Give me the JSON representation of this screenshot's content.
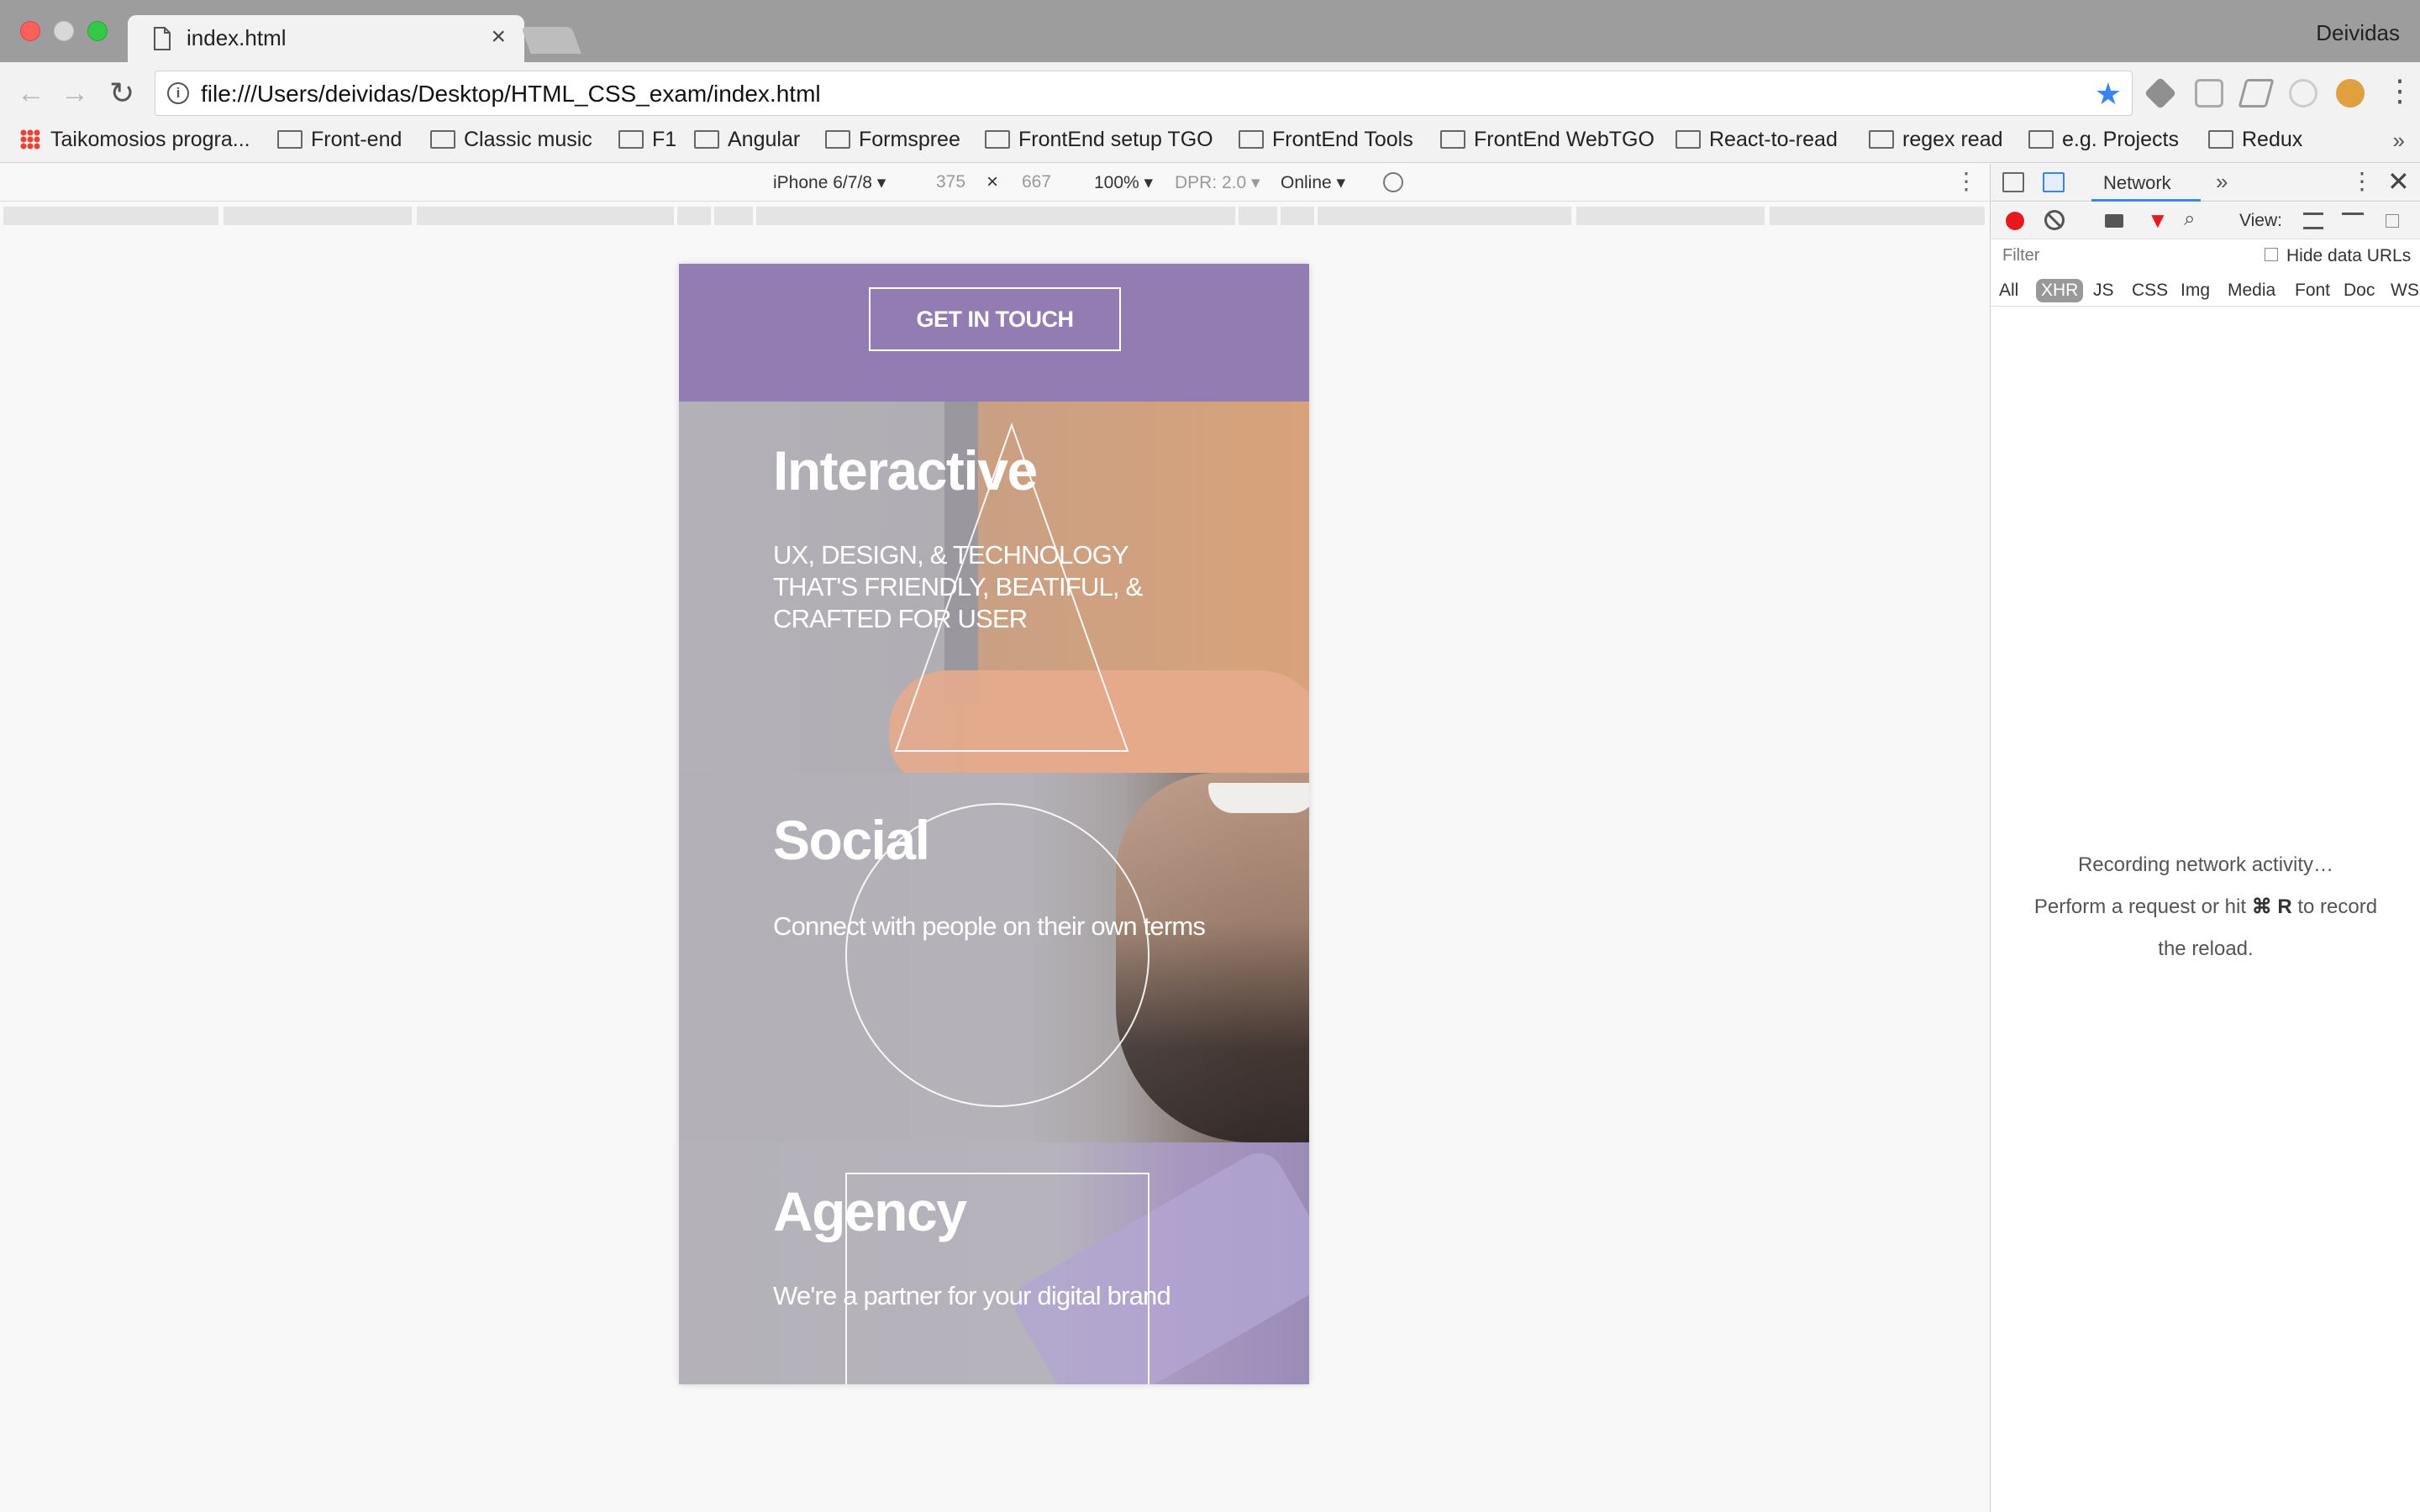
{
  "window": {
    "tab_title": "index.html",
    "tab_close": "×",
    "profile_name": "Deividas"
  },
  "toolbar": {
    "back": "←",
    "forward": "→",
    "reload": "↻",
    "info": "i",
    "url": "file:///Users/deividas/Desktop/HTML_CSS_exam/index.html",
    "star": "★",
    "menu": "⋮"
  },
  "bookmarks": [
    "Taikomosios progra...",
    "Front-end",
    "Classic music",
    "F1",
    "Angular",
    "Formspree",
    "FrontEnd setup TGO",
    "FrontEnd Tools",
    "FrontEnd WebTGO",
    "React-to-read",
    "regex read",
    "e.g. Projects",
    "Redux"
  ],
  "bookmarks_more": "»",
  "device_toolbar": {
    "device": "iPhone 6/7/8 ▾",
    "width": "375",
    "times": "×",
    "height": "667",
    "zoom": "100% ▾",
    "dpr": "DPR: 2.0 ▾",
    "network": "Online ▾",
    "more": "⋮"
  },
  "page": {
    "cta": "GET IN TOUCH",
    "sections": [
      {
        "title": "Interactive",
        "subtitle": "UX, DESIGN, & TECHNOLOGY THAT'S FRIENDLY, BEATIFUL, & CRAFTED FOR USER"
      },
      {
        "title": "Social",
        "subtitle": "Connect with people on their own terms"
      },
      {
        "title": "Agency",
        "subtitle": "We're a partner for your digital brand"
      }
    ]
  },
  "devtools": {
    "tab_network": "Network",
    "more_tabs": "»",
    "kebab": "⋮",
    "close": "✕",
    "filter_icon": "▼",
    "search_icon": "⌕",
    "view_label": "View:",
    "filter_placeholder": "Filter",
    "hide_data_urls": "Hide data URLs",
    "types": [
      "All",
      "XHR",
      "JS",
      "CSS",
      "Img",
      "Media",
      "Font",
      "Doc",
      "WS"
    ],
    "active_type": "XHR",
    "empty_line1": "Recording network activity…",
    "empty_line2_a": "Perform a request or hit ",
    "empty_line2_key": "⌘ R",
    "empty_line2_b": " to record",
    "empty_line3": "the reload."
  }
}
